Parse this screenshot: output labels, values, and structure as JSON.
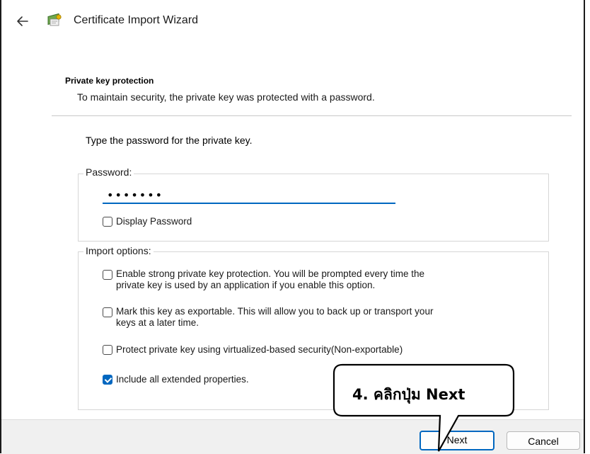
{
  "window": {
    "title": "Certificate Import Wizard",
    "back_icon": "back-arrow-icon",
    "app_icon": "certificate-icon"
  },
  "header": {
    "section_title": "Private key protection",
    "section_description": "To maintain security, the private key was protected with a password."
  },
  "body": {
    "instruction": "Type the password for the private key.",
    "password_group": {
      "legend": "Password:",
      "value": "•••••••",
      "display_password": {
        "label": "Display Password",
        "checked": false
      }
    },
    "import_options": {
      "legend": "Import options:",
      "items": [
        {
          "line1": "Enable strong private key protection. You will be prompted every time the",
          "line2": "private key is used by an application if you enable this option.",
          "checked": false
        },
        {
          "line1": "Mark this key as exportable. This will allow you to back up or transport your",
          "line2": "keys at a later time.",
          "checked": false
        },
        {
          "line1": "Protect private key using virtualized-based security(Non-exportable)",
          "checked": false
        },
        {
          "line1": "Include all extended properties.",
          "checked": true
        }
      ]
    }
  },
  "footer": {
    "next_label": "Next",
    "cancel_label": "Cancel"
  },
  "annotation": {
    "callout_text": "4. คลิกปุ่ม Next"
  },
  "colors": {
    "accent": "#0067c0",
    "footer_bg": "#f0f0f0",
    "border": "#d6d6d6"
  }
}
